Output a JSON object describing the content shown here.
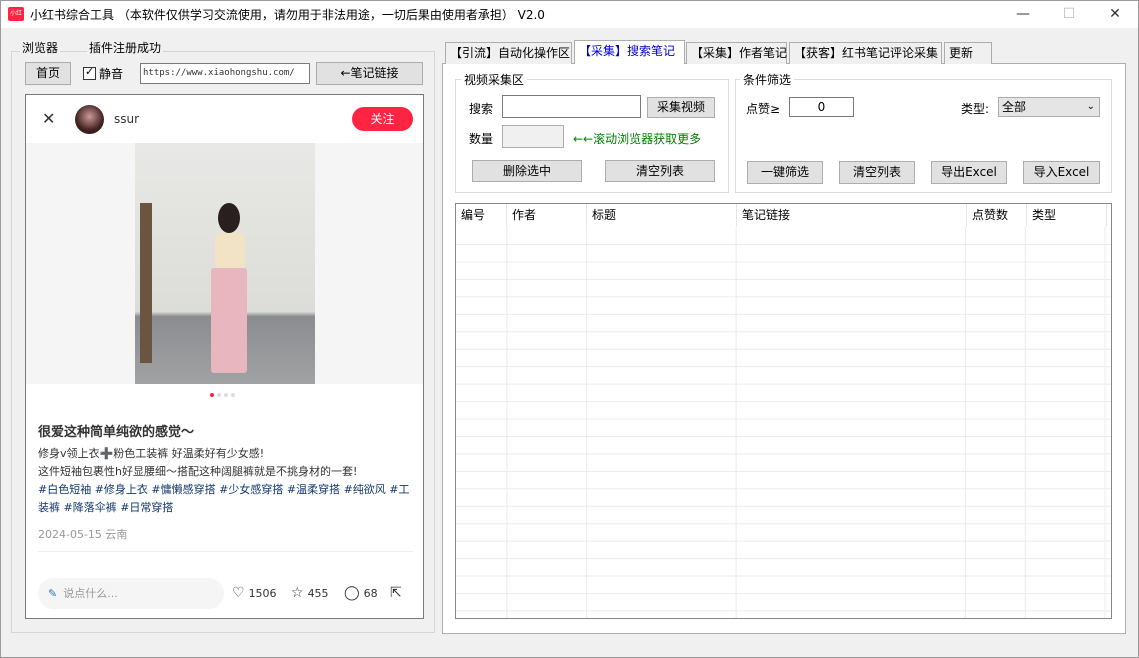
{
  "window": {
    "icon_text": "小红书",
    "title": "小红书综合工具  （本软件仅供学习交流使用，请勿用于非法用途，一切后果由使用者承担） V2.0",
    "min": "—",
    "max": "☐",
    "close": "✕"
  },
  "left": {
    "tab_browser": "浏览器",
    "plugin_status": "插件注册成功",
    "home_button": "首页",
    "mute_label": "静音",
    "mute_checked": true,
    "url": "https://www.xiaohongshu.com/",
    "note_link_button": "←笔记链接"
  },
  "note": {
    "author": "ssur",
    "follow": "关注",
    "title": "很爱这种简单纯欲的感觉～",
    "line1": "修身v领上衣➕粉色工装裤 好温柔好有少女感!",
    "line2": "这件短袖包裹性h好显腰细～搭配这种阔腿裤就是不挑身材的一套!",
    "tags": "#白色短袖  #修身上衣  #慵懒感穿搭  #少女感穿搭  #温柔穿搭  #纯欲风  #工装裤  #降落伞裤  #日常穿搭",
    "meta": "2024-05-15 云南",
    "comment_placeholder": "说点什么...",
    "likes": "1506",
    "stars": "455",
    "comments": "68"
  },
  "tabs": [
    "【引流】自动化操作区",
    "【采集】搜索笔记",
    "【采集】作者笔记",
    "【获客】红书笔记评论采集",
    "更新"
  ],
  "collect": {
    "legend": "视频采集区",
    "search_label": "搜索",
    "collect_button": "采集视频",
    "count_label": "数量",
    "hint": "←←滚动浏览器获取更多",
    "delete_button": "删除选中",
    "clear_button": "清空列表"
  },
  "filter": {
    "legend": "条件筛选",
    "likes_label": "点赞≥",
    "likes_value": "0",
    "type_label": "类型:",
    "type_value": "全部",
    "oneclick_button": "一键筛选",
    "clear_button": "清空列表",
    "export_button": "导出Excel",
    "import_button": "导入Excel"
  },
  "table": {
    "columns": [
      "编号",
      "作者",
      "标题",
      "笔记链接",
      "点赞数",
      "类型"
    ],
    "rows": []
  }
}
